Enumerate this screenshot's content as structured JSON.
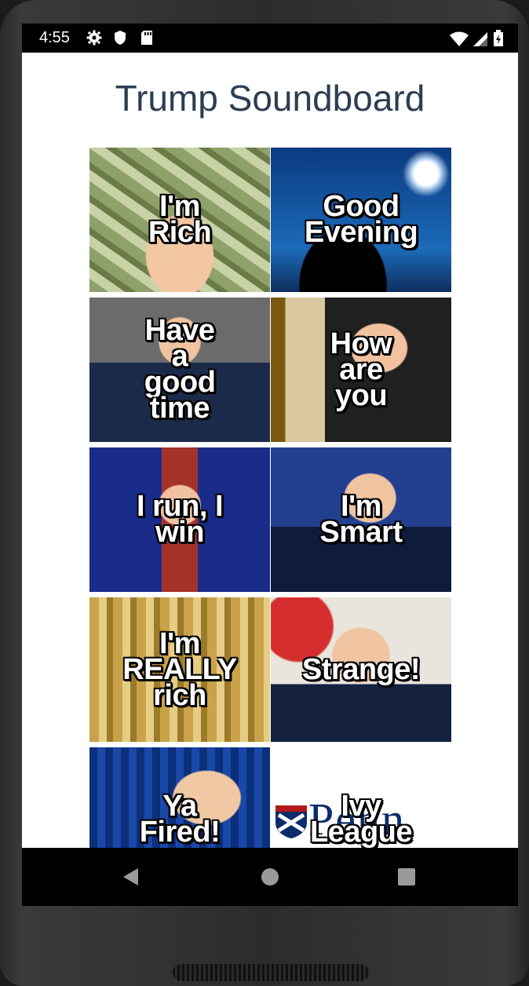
{
  "status_bar": {
    "time": "4:55",
    "icons_left": [
      "gear-icon",
      "shield-icon",
      "sd-card-icon"
    ],
    "icons_right": [
      "wifi-icon",
      "cellular-signal-icon",
      "battery-icon"
    ]
  },
  "app": {
    "title": "Trump Soundboard"
  },
  "tiles": [
    {
      "label": "I'm\nRich",
      "background": "money"
    },
    {
      "label": "Good\nEvening",
      "background": "night-sky"
    },
    {
      "label": "Have\na\ngood\ntime",
      "background": "gray-suit"
    },
    {
      "label": "How\nare\nyou",
      "background": "gold-curtain"
    },
    {
      "label": "I run, I\nwin",
      "background": "stage-red"
    },
    {
      "label": "I'm\nSmart",
      "background": "blue-stage"
    },
    {
      "label": "I'm\nREALLY\nrich",
      "background": "gold-room"
    },
    {
      "label": "Strange!",
      "background": "japan-flag"
    },
    {
      "label": "Ya\nFired!",
      "background": "blue-curtain"
    },
    {
      "label": "Ivy\nLeague",
      "background": "penn-logo"
    }
  ],
  "penn_logo_text": "Penn",
  "nav_bar": {
    "buttons": [
      "back-icon",
      "home-icon",
      "recents-icon"
    ]
  },
  "colors": {
    "title": "#2c3e50",
    "status_bar_bg": "#000000",
    "nav_bar_bg": "#000000",
    "screen_bg": "#ffffff"
  }
}
